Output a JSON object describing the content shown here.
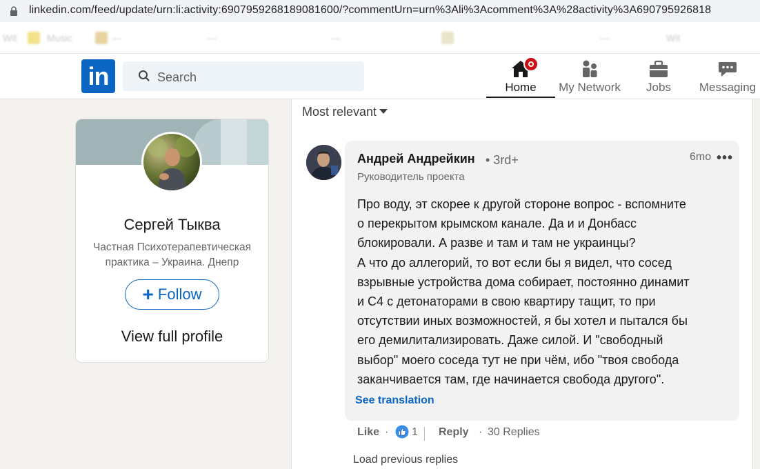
{
  "browser": {
    "url": "linkedin.com/feed/update/urn:li:activity:6907959268189081600/?commentUrn=urn%3Ali%3Acomment%3A%28activity%3A690795926818",
    "bookmarks": [
      "Wit",
      "Music",
      "—",
      "—",
      "—",
      "—",
      "Wit"
    ]
  },
  "header": {
    "logo_text": "in",
    "search_placeholder": "Search",
    "nav": [
      {
        "label": "Home",
        "icon": "home-icon",
        "active": true,
        "notification": true
      },
      {
        "label": "My Network",
        "icon": "network-icon"
      },
      {
        "label": "Jobs",
        "icon": "briefcase-icon"
      },
      {
        "label": "Messaging",
        "icon": "messaging-icon"
      }
    ]
  },
  "profile_card": {
    "name": "Сергей Тыква",
    "headline": "Частная Психотерапевтическая практика – Украина. Днепр",
    "follow_label": "Follow",
    "view_profile_label": "View full profile"
  },
  "feed": {
    "sort_label": "Most relevant",
    "comment": {
      "author": "Андрей Андрейкин",
      "degree": "• 3rd+",
      "author_headline": "Руководитель проекта",
      "time": "6mo",
      "text_lines": [
        "Про воду, эт скорее к другой стороне вопрос - вспомните",
        "о перекрытом крымском канале. Да и и Донбасс",
        "блокировали. А разве и там и там не украинцы?",
        "А что до аллегорий, то вот если бы я видел, что сосед",
        "взрывные устройства дома собирает, постоянно динамит",
        "и С4 с детонаторами в свою квартиру тащит, то при",
        "отсутствии иных возможностей, я бы хотел и пытался бы",
        "его демилитализировать. Даже силой. И \"свободный",
        "выбор\" моего соседа тут не при чём, ибо \"твоя свобода",
        "заканчивается там, где начинается свобода другого\"."
      ],
      "see_translation": "See translation",
      "like_label": "Like",
      "dot": "·",
      "like_count": "1",
      "reply_label": "Reply",
      "replies_label": "30 Replies"
    },
    "load_previous": "Load previous replies"
  },
  "colors": {
    "brand": "#0a66c2",
    "notification": "#cc1016",
    "page_bg": "#f3f2ef"
  }
}
